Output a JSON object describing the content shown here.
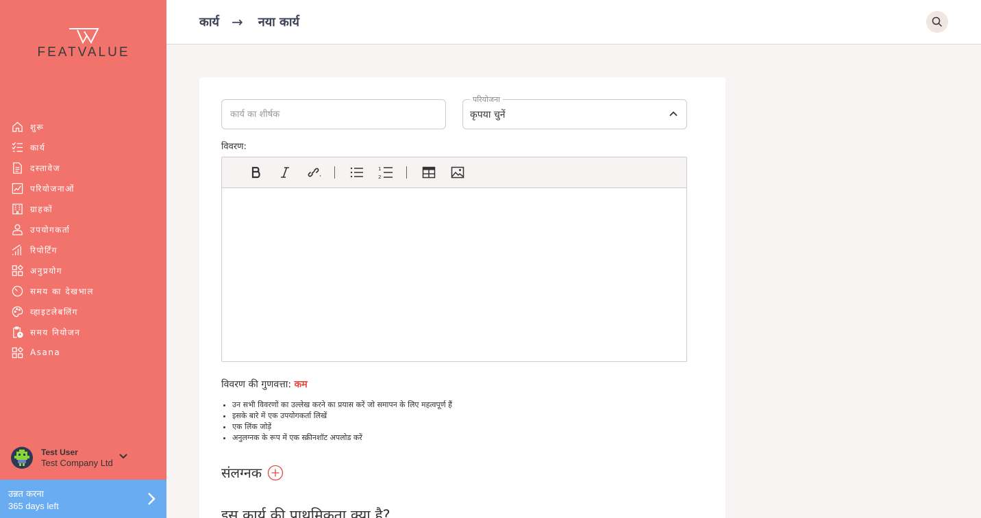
{
  "brand": {
    "name": "FEATVALUE"
  },
  "sidebar": {
    "items": [
      {
        "label": "शुरू",
        "icon": "home-icon"
      },
      {
        "label": "कार्य",
        "icon": "task-list-icon"
      },
      {
        "label": "दस्तावेज",
        "icon": "document-icon"
      },
      {
        "label": "परियोजनाओं",
        "icon": "chart-icon"
      },
      {
        "label": "ग्राहकों",
        "icon": "building-icon"
      },
      {
        "label": "उपयोगकर्ता",
        "icon": "user-icon"
      },
      {
        "label": "रिपोर्टिंग",
        "icon": "signal-icon"
      },
      {
        "label": "अनुप्रयोग",
        "icon": "apps-icon"
      },
      {
        "label": "समय का देखभाल",
        "icon": "timer-icon"
      },
      {
        "label": "व्हाइटलेबलिंग",
        "icon": "palette-icon"
      },
      {
        "label": "समय नियोजन",
        "icon": "clipboard-clock-icon"
      },
      {
        "label": "Asana",
        "icon": "apps-icon"
      }
    ]
  },
  "user": {
    "name": "Test User",
    "company": "Test Company Ltd"
  },
  "upgrade": {
    "title": "उन्नत करना",
    "subtitle": "365 days left"
  },
  "header": {
    "crumb_parent": "कार्य",
    "crumb_arrow": "→",
    "crumb_current": "नया कार्य"
  },
  "form": {
    "title_placeholder": "कार्य का शीर्षक",
    "project_label": "परियोजना",
    "project_value": "कृपया चुनें",
    "description_label": "विवरण:",
    "quality_label": "विवरण की गुणवत्ता:",
    "quality_value": "कम",
    "tips": [
      "उन सभी विवरणों का उल्लेख करने का प्रयास करें जो समापन के लिए महत्वपूर्ण हैं",
      "इसके बारे में एक उपयोगकर्ता लिखें",
      "एक लिंक जोड़ें",
      "अनुलग्नक के रूप में एक स्क्रीनशॉट अपलोड करें"
    ],
    "attachments_label": "संलग्नक",
    "priority_question": "इस कार्य की प्राथमिकता क्या है?"
  },
  "colors": {
    "sidebar": "#f2736b",
    "upgrade": "#6aacf1",
    "accent_red": "#e6473f"
  }
}
